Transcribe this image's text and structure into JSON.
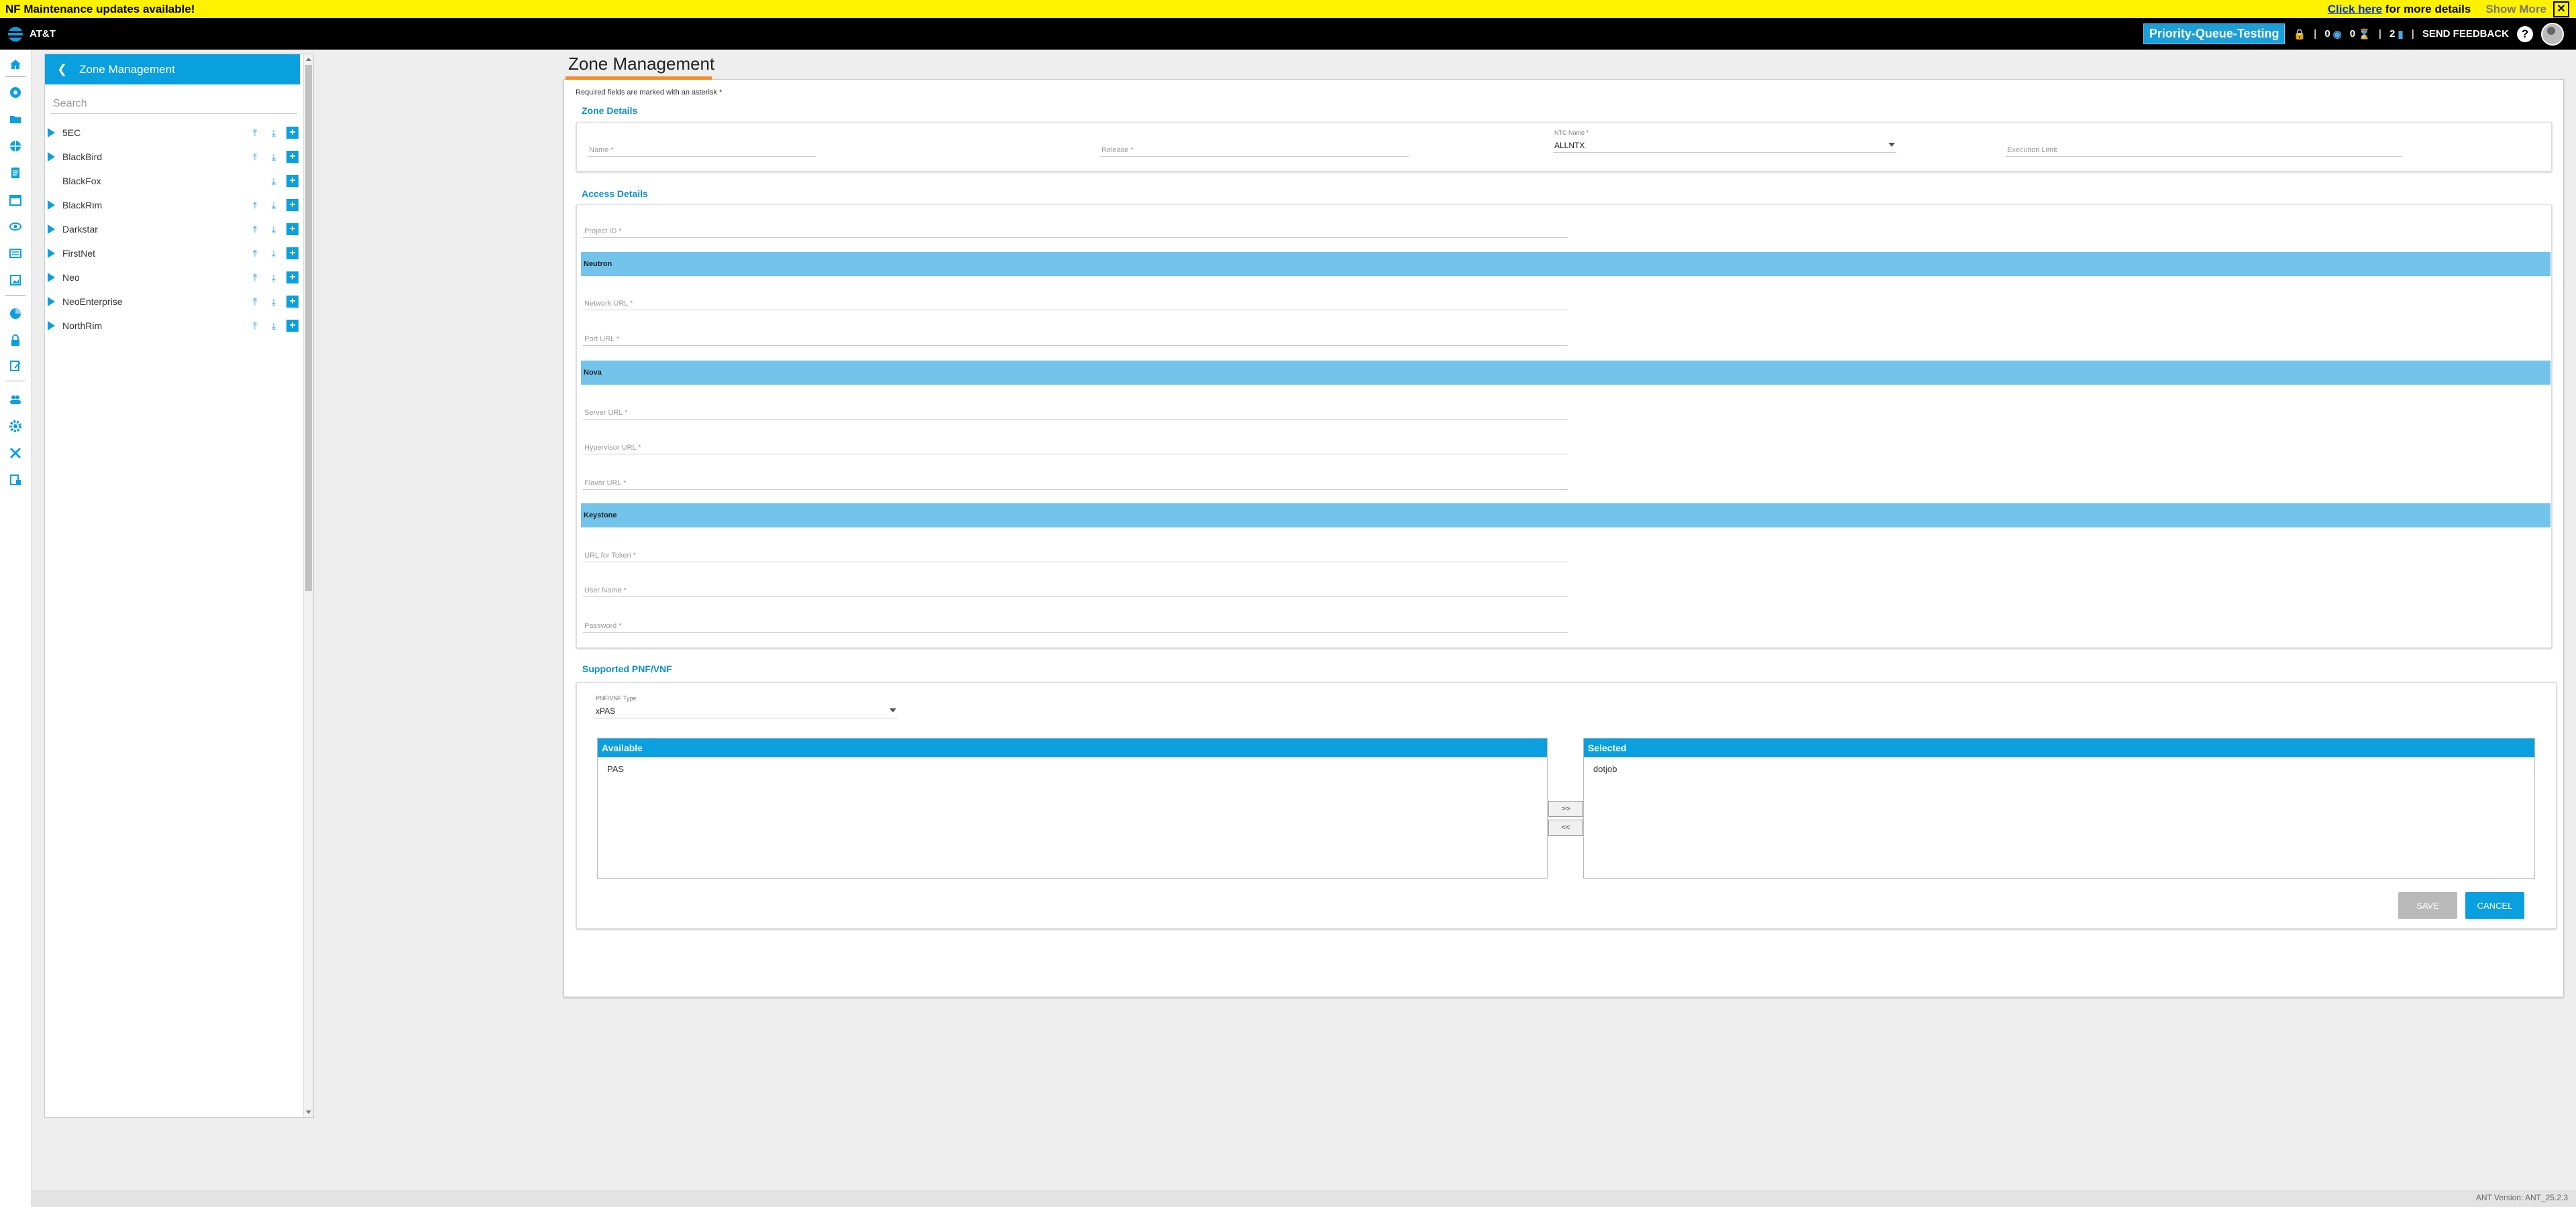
{
  "banner": {
    "message": "NF Maintenance updates available!",
    "link_text": "Click here",
    "link_suffix": "for more details",
    "show_more": "Show More",
    "bg_color": "#fff200"
  },
  "topbar": {
    "brand": "AT&T",
    "environment": "Priority-Queue-Testing",
    "count_a": "0",
    "count_b": "0",
    "count_c": "2",
    "feedback": "SEND FEEDBACK",
    "help": "?"
  },
  "sidebar_icons": [
    "home-icon",
    "rocket-icon",
    "folder-icon",
    "globe-icon",
    "document-icon",
    "calendar-icon",
    "eye-icon",
    "list-icon",
    "image-icon",
    "chart-icon",
    "lock-icon",
    "edit-icon",
    "users-icon",
    "settings-icon",
    "tools-icon",
    "report-icon"
  ],
  "tree": {
    "header": "Zone Management",
    "search_placeholder": "Search",
    "items": [
      {
        "label": "5EC",
        "expandable": true
      },
      {
        "label": "BlackBird",
        "expandable": true
      },
      {
        "label": "BlackFox",
        "expandable": false
      },
      {
        "label": "BlackRim",
        "expandable": true
      },
      {
        "label": "Darkstar",
        "expandable": true
      },
      {
        "label": "FirstNet",
        "expandable": true
      },
      {
        "label": "Neo",
        "expandable": true
      },
      {
        "label": "NeoEnterprise",
        "expandable": true
      },
      {
        "label": "NorthRim",
        "expandable": true
      }
    ]
  },
  "main": {
    "title": "Zone Management",
    "required_note": "Required fields are marked with an asterisk *",
    "zone_details": {
      "title": "Zone Details",
      "name_placeholder": "Name *",
      "release_placeholder": "Release *",
      "ntc_label": "NTC Name *",
      "ntc_value": "ALLNTX",
      "execution_limit_placeholder": "Execution Limit"
    },
    "access_details": {
      "title": "Access Details",
      "project_id": "Project ID *",
      "neutron": "Neutron",
      "network_url": "Network URL *",
      "port_url": "Port URL *",
      "nova": "Nova",
      "server_url": "Server URL *",
      "hypervisor_url": "Hypervisor URL *",
      "flavor_url": "Flavor URL *",
      "keystone": "Keystone",
      "token_url": "URL for Token *",
      "user_name": "User Name *",
      "password": "Password *"
    },
    "supported": {
      "title": "Supported PNF/VNF",
      "type_label": "PNF/VNF Type",
      "type_value": "xPAS",
      "available_header": "Available",
      "available_items": [
        "PAS"
      ],
      "selected_header": "Selected",
      "selected_items": [
        "dotjob"
      ],
      "move_right": ">>",
      "move_left": "<<"
    },
    "save": "SAVE",
    "cancel": "CANCEL"
  },
  "footer": {
    "version": "ANT Version: ANT_25.2.3"
  },
  "colors": {
    "accent": "#0aa0e0",
    "band": "#72c4ea",
    "title_underline": "#f28c28"
  }
}
